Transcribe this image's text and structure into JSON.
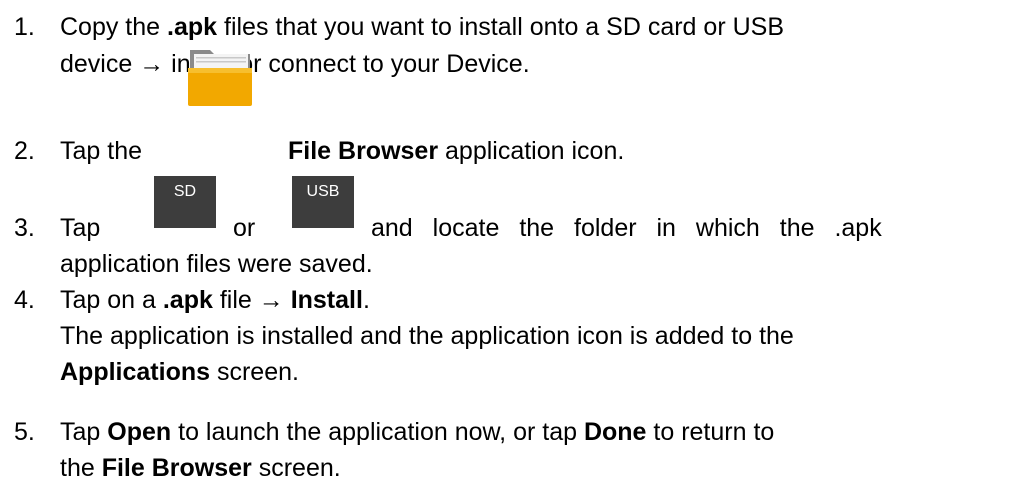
{
  "steps": [
    {
      "num": "1.",
      "p1": "Copy the ",
      "b1": ".apk",
      "p2": " files that you want to install onto a SD card or USB",
      "line2": "device → insert or connect to your Device."
    },
    {
      "num": "2.",
      "p1": "Tap the",
      "b1": "File Browser",
      "p2": " application icon.",
      "icon": "folder-icon"
    },
    {
      "num": "3.",
      "p1": "Tap",
      "sd": "SD",
      "or": "or",
      "usb": "USB",
      "p2": "and locate the folder in which the .apk",
      "line2": "application files were saved."
    },
    {
      "num": "4.",
      "p1": "Tap on a ",
      "b1": ".apk",
      "p2": " file → ",
      "b2": "Install",
      "p3": ".",
      "l2": "The application is installed and the application icon is added to the",
      "l3b": "Applications",
      "l3p": " screen."
    },
    {
      "num": "5.",
      "p1": "Tap ",
      "b1": "Open",
      "p2": " to launch the application now, or tap ",
      "b2": "Done",
      "p3": " to return to",
      "l2a": "the ",
      "l2b": "File Browser",
      "l2c": " screen."
    }
  ],
  "colors": {
    "text": "#000000",
    "button": "#3d3d3d",
    "folder": "#f2a800"
  }
}
